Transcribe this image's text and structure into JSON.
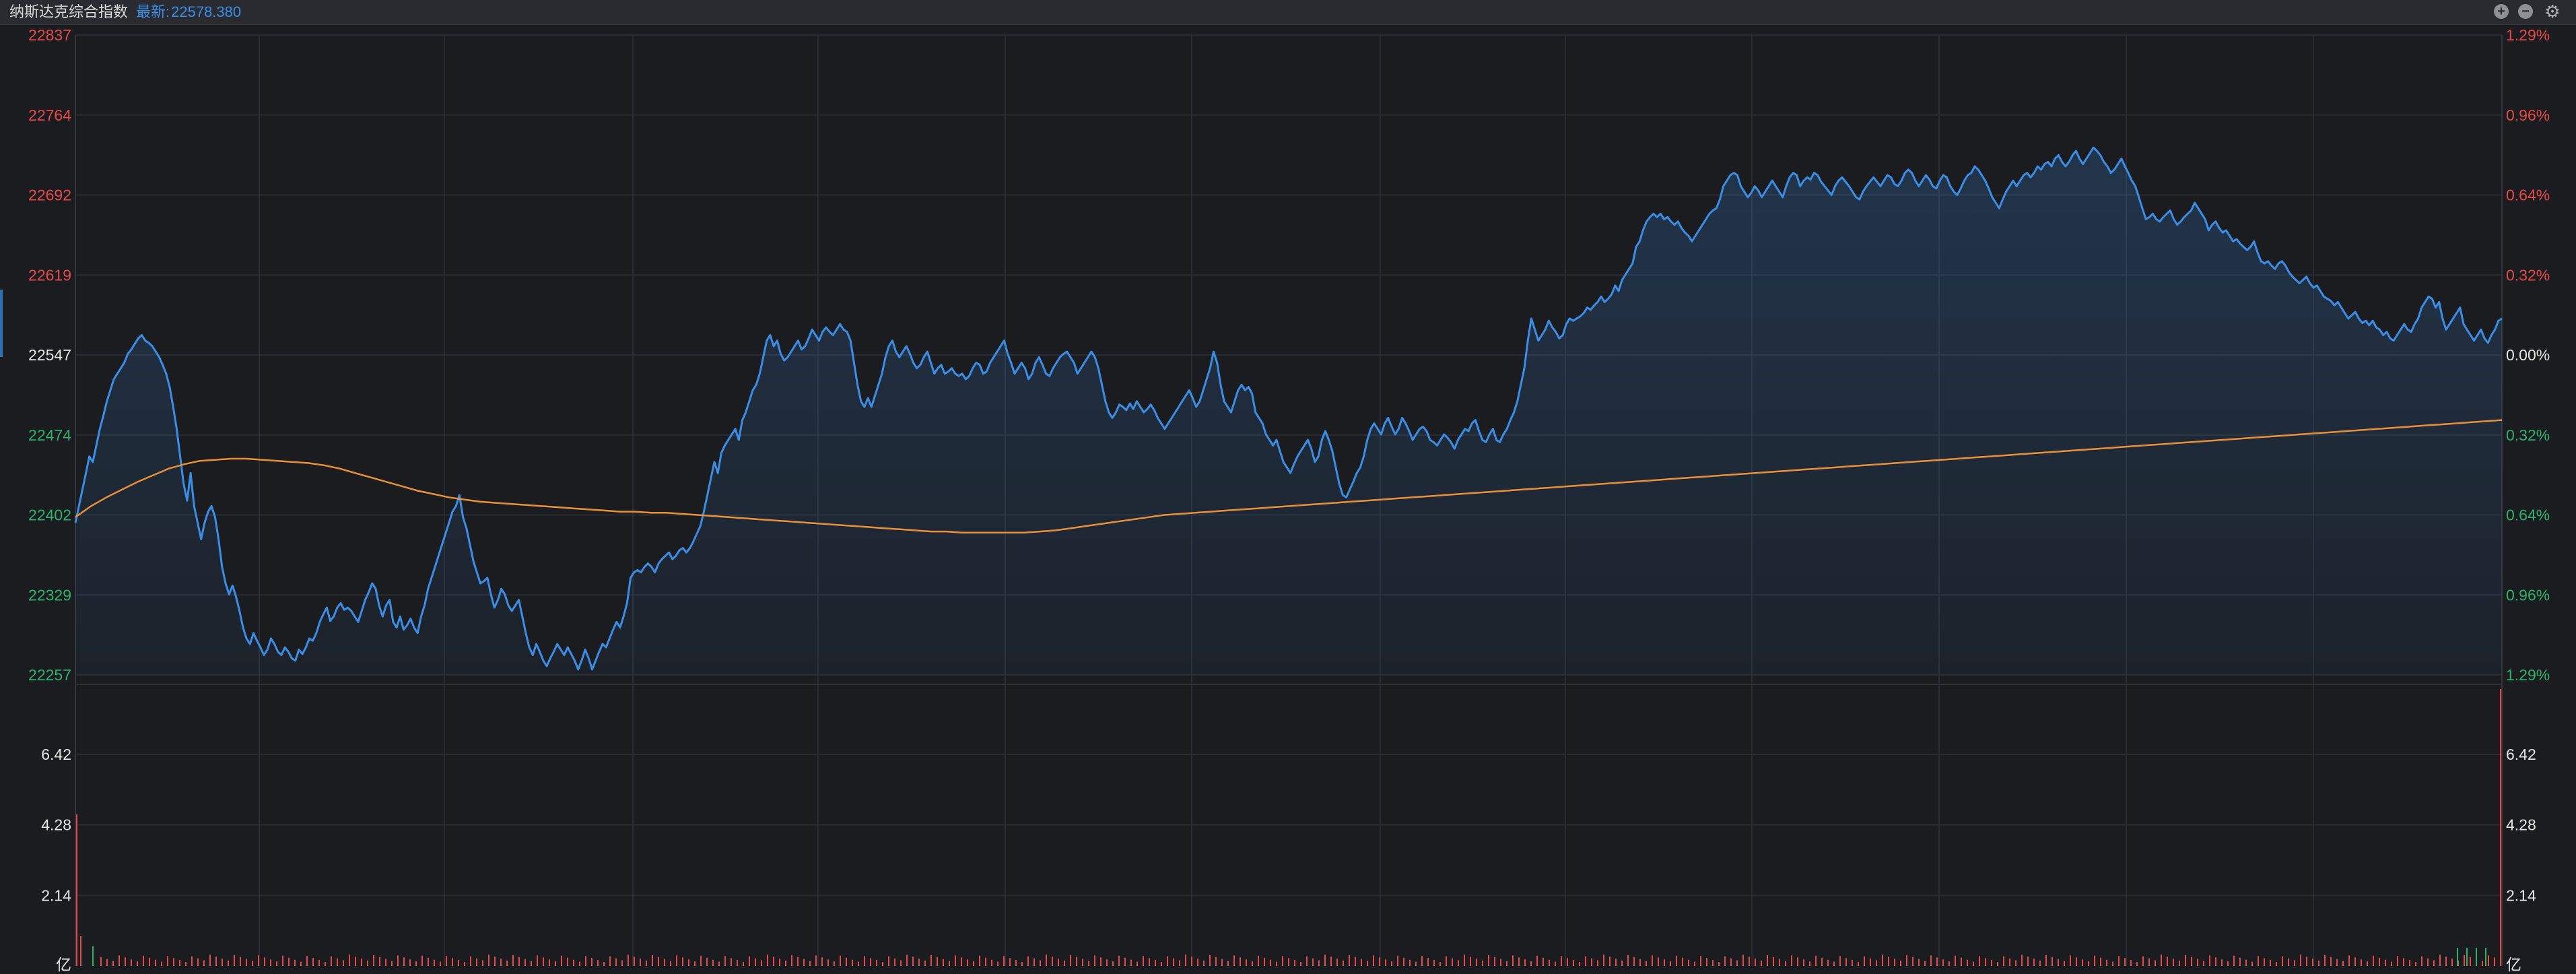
{
  "header": {
    "title": "纳斯达克综合指数",
    "latest_label": "最新:",
    "latest_value": "22578.380"
  },
  "controls": {
    "zoom_in_icon": "plus-circle-icon",
    "zoom_out_icon": "minus-circle-icon",
    "settings_icon": "gear-icon"
  },
  "colors": {
    "background": "#1b1c20",
    "price_line": "#3a8ee6",
    "avg_line": "#e8913a",
    "up": "#e84a4a",
    "down": "#2fb36a",
    "neutral_label": "#e6e6e6",
    "grid": "#2a2c31"
  },
  "chart_data": {
    "type": "line",
    "title": "纳斯达克综合指数",
    "prev_close": 22547,
    "ylim": [
      22257,
      22837
    ],
    "y_ticks_left": [
      "22837",
      "22764",
      "22692",
      "22619",
      "22547",
      "22474",
      "22402",
      "22329",
      "22257"
    ],
    "y_ticks_right": [
      "1.29%",
      "0.96%",
      "0.64%",
      "0.32%",
      "0.00%",
      "0.32%",
      "0.64%",
      "0.96%",
      "1.29%"
    ],
    "series": [
      {
        "values": [
          22395,
          22410,
          22425,
          22440,
          22455,
          22450,
          22465,
          22480,
          22492,
          22505,
          22515,
          22525,
          22530,
          22535,
          22540,
          22548,
          22552,
          22557,
          22562,
          22565,
          22560,
          22558,
          22555,
          22550,
          22545,
          22538,
          22530,
          22518,
          22500,
          22480,
          22455,
          22430,
          22415,
          22440,
          22410,
          22395,
          22380,
          22395,
          22405,
          22410,
          22400,
          22380,
          22355,
          22340,
          22330,
          22338,
          22328,
          22315,
          22300,
          22290,
          22285,
          22295,
          22288,
          22282,
          22275,
          22280,
          22290,
          22285,
          22278,
          22275,
          22282,
          22278,
          22272,
          22270,
          22280,
          22276,
          22282,
          22290,
          22288,
          22295,
          22305,
          22312,
          22318,
          22306,
          22310,
          22318,
          22322,
          22316,
          22318,
          22315,
          22310,
          22305,
          22315,
          22325,
          22332,
          22340,
          22335,
          22320,
          22310,
          22320,
          22325,
          22305,
          22300,
          22310,
          22298,
          22302,
          22308,
          22300,
          22295,
          22310,
          22320,
          22335,
          22345,
          22355,
          22365,
          22375,
          22385,
          22395,
          22405,
          22410,
          22420,
          22400,
          22390,
          22375,
          22360,
          22350,
          22340,
          22342,
          22345,
          22330,
          22318,
          22325,
          22335,
          22330,
          22320,
          22315,
          22320,
          22325,
          22310,
          22295,
          22282,
          22275,
          22285,
          22278,
          22270,
          22265,
          22272,
          22278,
          22285,
          22280,
          22275,
          22282,
          22276,
          22270,
          22262,
          22270,
          22280,
          22272,
          22262,
          22270,
          22278,
          22285,
          22282,
          22290,
          22298,
          22305,
          22300,
          22310,
          22322,
          22345,
          22350,
          22352,
          22350,
          22355,
          22358,
          22355,
          22350,
          22358,
          22362,
          22365,
          22368,
          22362,
          22365,
          22370,
          22372,
          22368,
          22372,
          22378,
          22385,
          22392,
          22405,
          22420,
          22435,
          22450,
          22440,
          22458,
          22465,
          22470,
          22475,
          22480,
          22470,
          22488,
          22495,
          22505,
          22515,
          22520,
          22530,
          22545,
          22560,
          22565,
          22555,
          22560,
          22548,
          22542,
          22545,
          22550,
          22555,
          22560,
          22552,
          22555,
          22562,
          22570,
          22565,
          22560,
          22568,
          22572,
          22568,
          22565,
          22570,
          22575,
          22570,
          22568,
          22560,
          22540,
          22520,
          22505,
          22500,
          22508,
          22500,
          22510,
          22520,
          22530,
          22545,
          22555,
          22560,
          22550,
          22545,
          22550,
          22555,
          22548,
          22540,
          22535,
          22538,
          22545,
          22550,
          22540,
          22530,
          22535,
          22538,
          22530,
          22532,
          22535,
          22530,
          22528,
          22530,
          22525,
          22528,
          22535,
          22540,
          22538,
          22530,
          22532,
          22540,
          22545,
          22550,
          22555,
          22560,
          22548,
          22540,
          22530,
          22535,
          22540,
          22535,
          22525,
          22530,
          22540,
          22545,
          22538,
          22530,
          22528,
          22535,
          22540,
          22545,
          22548,
          22550,
          22545,
          22540,
          22530,
          22535,
          22540,
          22545,
          22550,
          22545,
          22535,
          22520,
          22505,
          22495,
          22490,
          22495,
          22502,
          22500,
          22497,
          22503,
          22498,
          22505,
          22500,
          22495,
          22498,
          22502,
          22497,
          22490,
          22485,
          22480,
          22485,
          22490,
          22495,
          22500,
          22505,
          22510,
          22515,
          22508,
          22500,
          22505,
          22515,
          22525,
          22535,
          22550,
          22540,
          22520,
          22505,
          22500,
          22495,
          22505,
          22515,
          22520,
          22515,
          22518,
          22512,
          22495,
          22490,
          22485,
          22475,
          22470,
          22465,
          22470,
          22460,
          22450,
          22445,
          22440,
          22448,
          22455,
          22460,
          22465,
          22470,
          22462,
          22450,
          22455,
          22470,
          22478,
          22470,
          22460,
          22445,
          22430,
          22420,
          22418,
          22425,
          22432,
          22440,
          22445,
          22455,
          22470,
          22480,
          22485,
          22480,
          22475,
          22485,
          22490,
          22482,
          22475,
          22480,
          22490,
          22485,
          22478,
          22470,
          22475,
          22480,
          22482,
          22478,
          22470,
          22468,
          22465,
          22470,
          22475,
          22472,
          22468,
          22462,
          22470,
          22475,
          22480,
          22478,
          22485,
          22488,
          22478,
          22470,
          22468,
          22475,
          22480,
          22470,
          22468,
          22475,
          22480,
          22488,
          22495,
          22505,
          22520,
          22535,
          22560,
          22580,
          22570,
          22560,
          22565,
          22570,
          22578,
          22572,
          22568,
          22562,
          22565,
          22575,
          22580,
          22578,
          22580,
          22582,
          22585,
          22590,
          22588,
          22592,
          22595,
          22600,
          22595,
          22598,
          22602,
          22610,
          22605,
          22615,
          22620,
          22625,
          22630,
          22645,
          22650,
          22660,
          22668,
          22672,
          22675,
          22672,
          22675,
          22670,
          22672,
          22668,
          22665,
          22668,
          22662,
          22658,
          22655,
          22650,
          22655,
          22660,
          22665,
          22670,
          22675,
          22678,
          22680,
          22688,
          22700,
          22705,
          22710,
          22712,
          22710,
          22700,
          22695,
          22690,
          22694,
          22700,
          22696,
          22690,
          22695,
          22700,
          22705,
          22700,
          22695,
          22690,
          22700,
          22708,
          22712,
          22710,
          22700,
          22705,
          22708,
          22706,
          22712,
          22710,
          22704,
          22700,
          22696,
          22692,
          22700,
          22705,
          22708,
          22704,
          22700,
          22695,
          22690,
          22688,
          22695,
          22700,
          22704,
          22708,
          22704,
          22700,
          22705,
          22710,
          22708,
          22702,
          22700,
          22705,
          22712,
          22715,
          22712,
          22705,
          22700,
          22705,
          22710,
          22706,
          22700,
          22698,
          22705,
          22710,
          22708,
          22700,
          22695,
          22692,
          22698,
          22705,
          22710,
          22712,
          22718,
          22715,
          22710,
          22705,
          22698,
          22690,
          22685,
          22680,
          22688,
          22695,
          22700,
          22705,
          22700,
          22705,
          22710,
          22712,
          22708,
          22712,
          22718,
          22715,
          22720,
          22722,
          22718,
          22725,
          22728,
          22722,
          22718,
          22722,
          22728,
          22732,
          22725,
          22720,
          22725,
          22730,
          22735,
          22732,
          22728,
          22722,
          22718,
          22712,
          22715,
          22720,
          22725,
          22718,
          22712,
          22705,
          22700,
          22690,
          22680,
          22670,
          22672,
          22675,
          22670,
          22668,
          22672,
          22675,
          22678,
          22670,
          22665,
          22668,
          22672,
          22675,
          22678,
          22685,
          22680,
          22675,
          22670,
          22660,
          22665,
          22668,
          22662,
          22658,
          22660,
          22655,
          22650,
          22652,
          22648,
          22645,
          22642,
          22645,
          22650,
          22640,
          22632,
          22630,
          22632,
          22628,
          22625,
          22630,
          22632,
          22628,
          22622,
          22618,
          22615,
          22612,
          22615,
          22618,
          22612,
          22608,
          22610,
          22605,
          22600,
          22598,
          22596,
          22592,
          22595,
          22590,
          22585,
          22580,
          22583,
          22586,
          22580,
          22576,
          22578,
          22574,
          22578,
          22572,
          22570,
          22565,
          22568,
          22562,
          22560,
          22565,
          22570,
          22575,
          22570,
          22568,
          22575,
          22580,
          22590,
          22595,
          22600,
          22598,
          22590,
          22595,
          22580,
          22570,
          22575,
          22580,
          22585,
          22590,
          22575,
          22570,
          22565,
          22560,
          22565,
          22570,
          22562,
          22558,
          22565,
          22570,
          22578,
          22580
        ]
      },
      {
        "values": [
          22400,
          22410,
          22418,
          22425,
          22432,
          22438,
          22444,
          22448,
          22451,
          22452,
          22453,
          22453,
          22452,
          22451,
          22450,
          22449,
          22447,
          22444,
          22440,
          22436,
          22432,
          22428,
          22424,
          22421,
          22418,
          22416,
          22414,
          22413,
          22412,
          22411,
          22410,
          22409,
          22408,
          22407,
          22406,
          22405,
          22405,
          22404,
          22404,
          22403,
          22402,
          22401,
          22400,
          22399,
          22398,
          22397,
          22396,
          22395,
          22394,
          22393,
          22392,
          22391,
          22390,
          22389,
          22388,
          22387,
          22387,
          22386,
          22386,
          22386,
          22386,
          22386,
          22387,
          22388,
          22390,
          22392,
          22394,
          22396,
          22398,
          22400,
          22402,
          22403,
          22404,
          22405,
          22406,
          22407,
          22408,
          22409,
          22410,
          22411,
          22412,
          22413,
          22414,
          22415,
          22416,
          22417,
          22418,
          22419,
          22420,
          22421,
          22422,
          22423,
          22424,
          22425,
          22426,
          22427,
          22428,
          22429,
          22430,
          22431,
          22432,
          22433,
          22434,
          22435,
          22436,
          22437,
          22438,
          22439,
          22440,
          22441,
          22442,
          22443,
          22444,
          22445,
          22446,
          22447,
          22448,
          22449,
          22450,
          22451,
          22452,
          22453,
          22454,
          22455,
          22456,
          22457,
          22458,
          22459,
          22460,
          22461,
          22462,
          22463,
          22464,
          22465,
          22466,
          22467,
          22468,
          22469,
          22470,
          22471,
          22472,
          22473,
          22474,
          22475,
          22476,
          22477,
          22478,
          22479,
          22480,
          22481,
          22482,
          22483,
          22484,
          22485,
          22486,
          22487,
          22488
        ]
      }
    ],
    "volume": {
      "unit_label": "亿",
      "ticks": [
        "6.42",
        "4.28",
        "2.14"
      ],
      "ylim": [
        0,
        8.56
      ]
    }
  }
}
